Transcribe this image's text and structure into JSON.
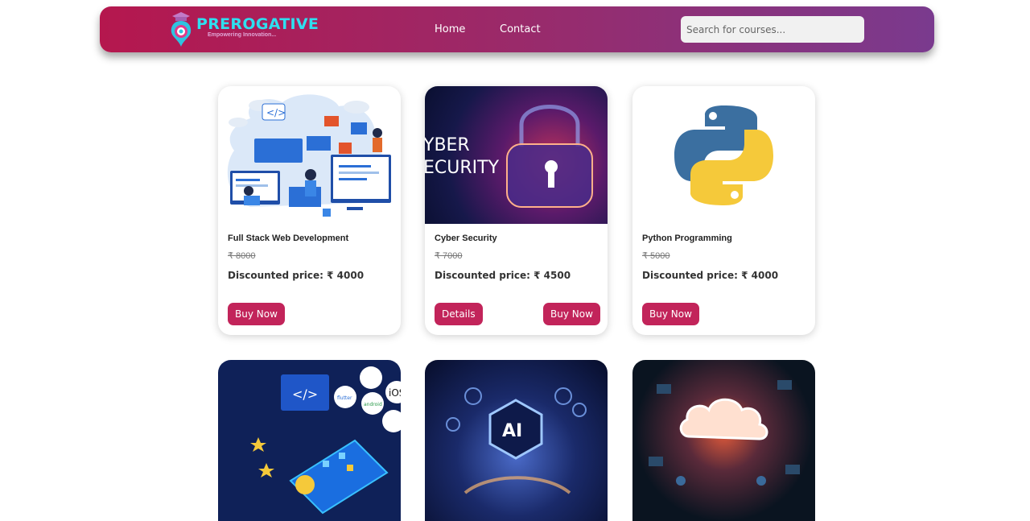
{
  "header": {
    "logo_title": "PREROGATIVE",
    "logo_tagline": "Empowering Innovation...",
    "nav": [
      {
        "label": "Home"
      },
      {
        "label": "Contact"
      }
    ],
    "search": {
      "placeholder": "Search for courses...",
      "value": ""
    }
  },
  "currency_symbol": "₹",
  "courses": [
    {
      "title": "Full Stack Web Development",
      "original_price": "₹ 8000",
      "discounted_price": "Discounted price: ₹ 4000",
      "buttons": {
        "buy": "Buy Now"
      },
      "image": "web-development-illustration"
    },
    {
      "title": "Cyber Security",
      "original_price": "₹ 7000",
      "discounted_price": "Discounted price: ₹ 4500",
      "buttons": {
        "details": "Details",
        "buy": "Buy Now"
      },
      "image": "cyber-security-lock",
      "image_text": [
        "YBER",
        "ECURITY"
      ]
    },
    {
      "title": "Python Programming",
      "original_price": "₹ 5000",
      "discounted_price": "Discounted price: ₹ 4000",
      "buttons": {
        "buy": "Buy Now"
      },
      "image": "python-logo"
    }
  ],
  "lower_cards": [
    {
      "image": "app-development-illustration",
      "image_text": [
        "</>",
        "flutter",
        "android",
        "iOS"
      ]
    },
    {
      "image": "ai-hand-illustration",
      "image_text": [
        "AI"
      ]
    },
    {
      "image": "cloud-computing-illustration"
    }
  ],
  "colors": {
    "nav_gradient_start": "#b5174e",
    "nav_gradient_end": "#7a3a8e",
    "logo_text": "#2ee0f0",
    "button": "#c2245a"
  }
}
